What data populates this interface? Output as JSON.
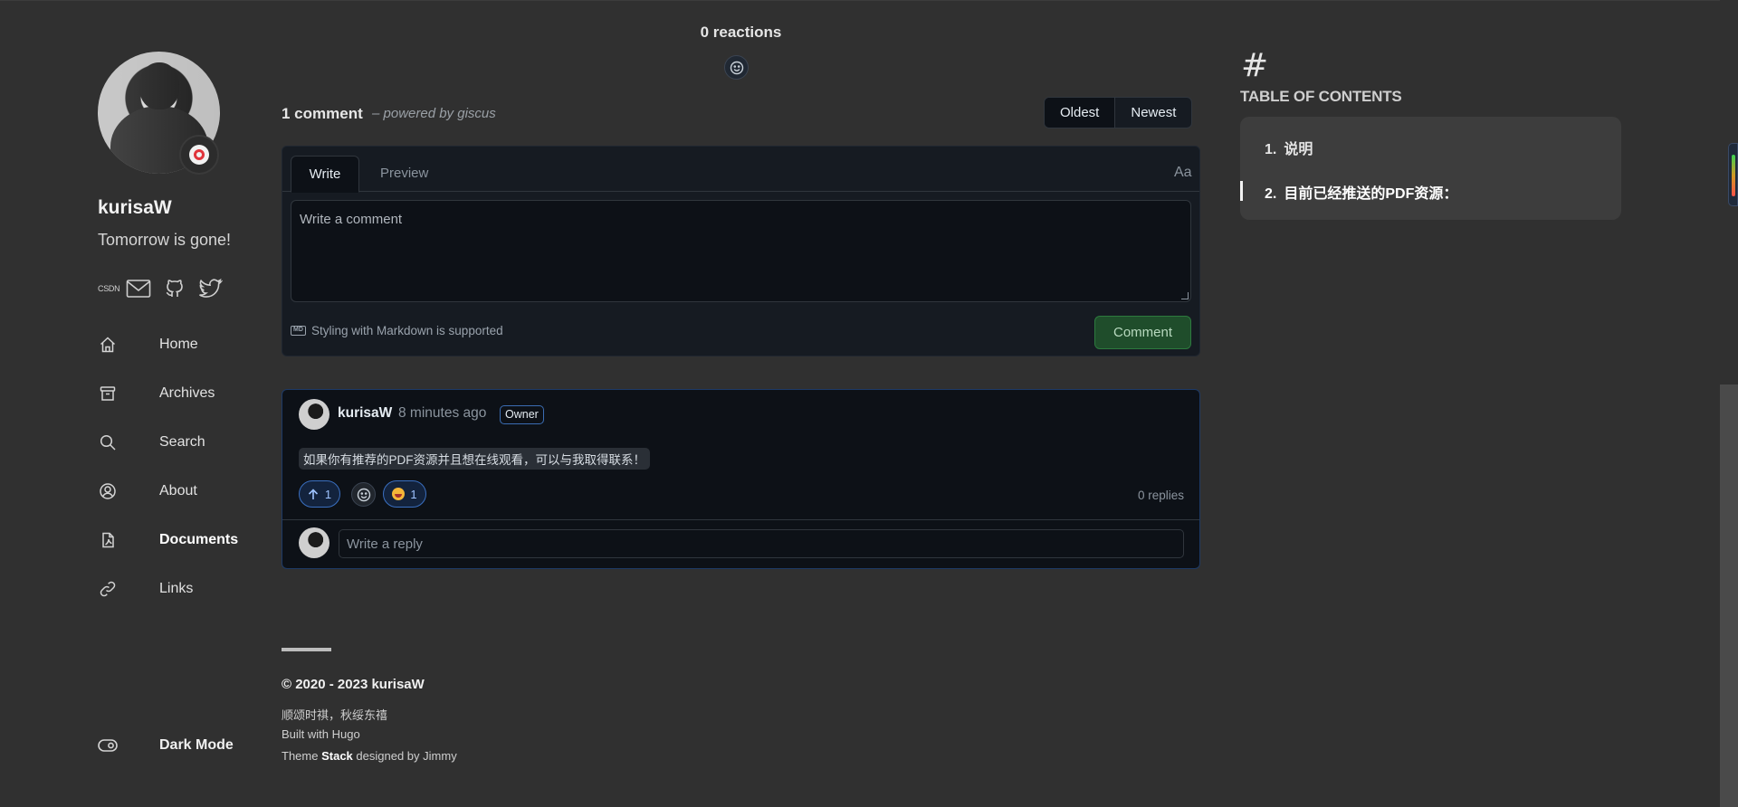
{
  "sidebar": {
    "site_name": "kurisaW",
    "site_desc": "Tomorrow is gone!",
    "social": {
      "csdn_label": "CSDN"
    },
    "menu": [
      {
        "label": "Home",
        "icon": "home-icon"
      },
      {
        "label": "Archives",
        "icon": "archive-icon"
      },
      {
        "label": "Search",
        "icon": "search-icon"
      },
      {
        "label": "About",
        "icon": "user-icon"
      },
      {
        "label": "Documents",
        "icon": "pdf-icon",
        "active": true
      },
      {
        "label": "Links",
        "icon": "link-icon"
      }
    ],
    "dark_mode_label": "Dark Mode"
  },
  "giscus": {
    "reactions_label": "0 reactions",
    "comment_count": "1 comment",
    "powered_by": "– powered by giscus",
    "sort": {
      "oldest": "Oldest",
      "newest": "Newest",
      "selected": "Oldest"
    },
    "editor": {
      "tab_write": "Write",
      "tab_preview": "Preview",
      "font_toggle": "Aa",
      "placeholder": "Write a comment",
      "markdown_hint": "Styling with Markdown is supported",
      "md_badge": "MD",
      "submit_label": "Comment"
    },
    "comment": {
      "author": "kurisaW",
      "time": "8 minutes ago",
      "badge": "Owner",
      "body": "如果你有推荐的PDF资源并且想在线观看，可以与我取得联系！",
      "upvote_count": "1",
      "smile_count": "1",
      "replies_label": "0 replies",
      "reply_placeholder": "Write a reply"
    }
  },
  "footer": {
    "copyright": "© 2020 - 2023 kurisaW",
    "motto": "顺颂时祺，秋绥东禧",
    "built_with": "Built with Hugo",
    "theme_prefix": "Theme",
    "theme_name": "Stack",
    "theme_suffix": "designed by Jimmy"
  },
  "toc": {
    "hash": "#",
    "title": "TABLE OF CONTENTS",
    "items": [
      {
        "num": "1.",
        "label": "说明"
      },
      {
        "num": "2.",
        "label": "目前已经推送的PDF资源：",
        "active": true
      }
    ]
  },
  "colors": {
    "page_bg": "#303030",
    "giscus_bg": "#0d1117",
    "accent_blue": "#3a6fc0",
    "comment_green": "#1f4d2b"
  }
}
